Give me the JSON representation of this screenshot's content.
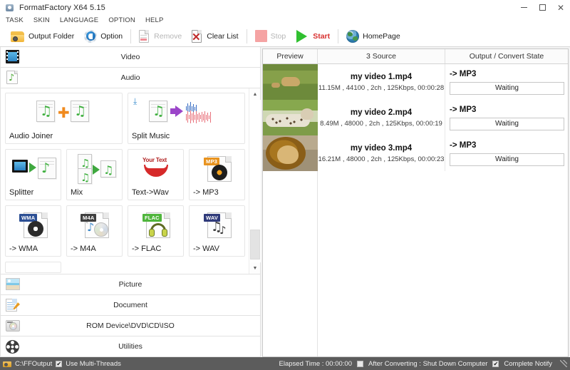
{
  "window": {
    "title": "FormatFactory X64 5.15",
    "icon": "app-icon",
    "minimize": "–",
    "maximize": "□",
    "close": "✕"
  },
  "menubar": {
    "items": [
      {
        "label": "TASK"
      },
      {
        "label": "SKIN"
      },
      {
        "label": "LANGUAGE"
      },
      {
        "label": "OPTION"
      },
      {
        "label": "HELP"
      }
    ]
  },
  "toolbar": {
    "output_folder": "Output Folder",
    "option": "Option",
    "remove": "Remove",
    "clear_list": "Clear List",
    "stop": "Stop",
    "start": "Start",
    "homepage": "HomePage"
  },
  "sidebar": {
    "categories_top": [
      {
        "label": "Video",
        "icon": "film-icon"
      },
      {
        "label": "Audio",
        "icon": "music-note-icon"
      }
    ],
    "categories_bottom": [
      {
        "label": "Picture",
        "icon": "picture-icon"
      },
      {
        "label": "Document",
        "icon": "document-icon"
      },
      {
        "label": "ROM Device\\DVD\\CD\\ISO",
        "icon": "disc-icon"
      },
      {
        "label": "Utilities",
        "icon": "film-reel-icon"
      }
    ],
    "tiles_row1": [
      {
        "label": "Audio Joiner",
        "icon": "audio-joiner-icon"
      },
      {
        "label": "Split Music",
        "icon": "split-music-icon"
      }
    ],
    "tiles_row2": [
      {
        "label": "Splitter",
        "icon": "splitter-icon"
      },
      {
        "label": "Mix",
        "icon": "mix-icon"
      },
      {
        "label": "Text->Wav",
        "icon": "text-to-wav-icon"
      },
      {
        "label": "-> MP3",
        "icon": "mp3-file-icon",
        "badge": "MP3"
      }
    ],
    "tiles_row3": [
      {
        "label": "-> WMA",
        "icon": "wma-file-icon",
        "badge": "WMA"
      },
      {
        "label": "-> M4A",
        "icon": "m4a-file-icon",
        "badge": "M4A"
      },
      {
        "label": "-> FLAC",
        "icon": "flac-file-icon",
        "badge": "FLAC"
      },
      {
        "label": "-> WAV",
        "icon": "wav-file-icon",
        "badge": "WAV"
      }
    ],
    "yourtext_label": "Your Text"
  },
  "filelist": {
    "headers": {
      "preview": "Preview",
      "source": "3 Source",
      "output": "Output / Convert State"
    },
    "rows": [
      {
        "name": "my video 1.mp4",
        "info": "11.15M , 44100 , 2ch , 125Kbps, 00:00:28",
        "target": "-> MP3",
        "state": "Waiting",
        "thumb": "lioness-thumbnail"
      },
      {
        "name": "my video 2.mp4",
        "info": "8.49M , 48000 , 2ch , 125Kbps, 00:00:19",
        "target": "-> MP3",
        "state": "Waiting",
        "thumb": "cheetah-thumbnail"
      },
      {
        "name": "my video 3.mp4",
        "info": "16.21M , 48000 , 2ch , 125Kbps, 00:00:23",
        "target": "-> MP3",
        "state": "Waiting",
        "thumb": "lion-thumbnail"
      }
    ]
  },
  "statusbar": {
    "output_path": "C:\\FFOutput",
    "multi_threads": "Use Multi-Threads",
    "multi_threads_checked": "✔",
    "elapsed": "Elapsed Time : 00:00:00",
    "after_converting": "After Converting : Shut Down Computer",
    "after_converting_checked": "",
    "complete_notify": "Complete Notify",
    "complete_notify_checked": "✔"
  },
  "colors": {
    "accent_green": "#30c030",
    "start_red": "#d8302f",
    "stop_pink": "#f5a3a3",
    "statusbar_bg": "#5c5c5c"
  }
}
